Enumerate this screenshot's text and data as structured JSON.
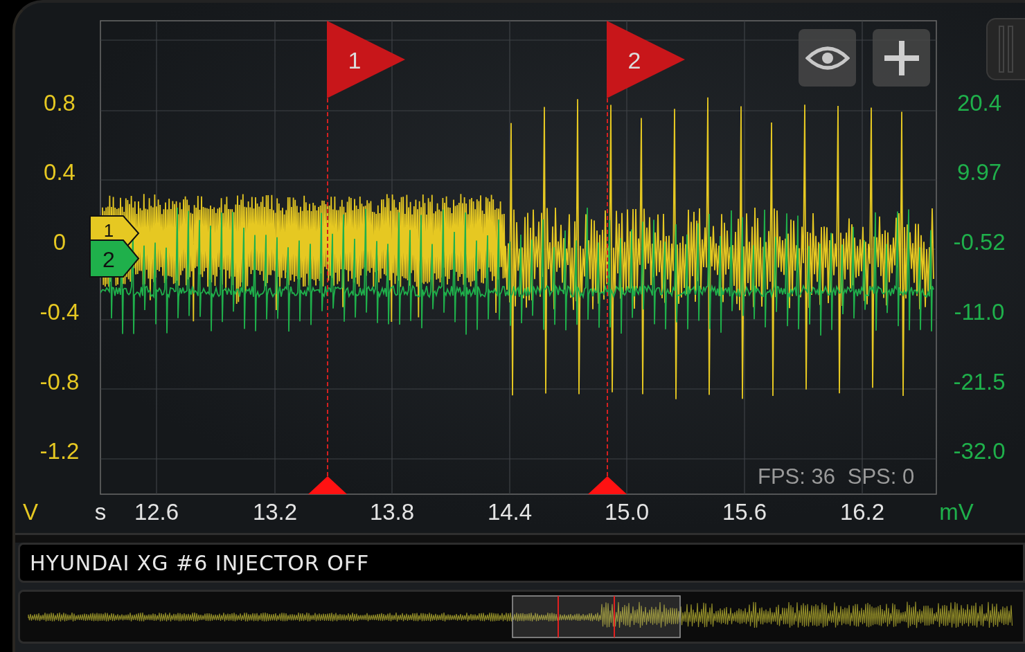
{
  "scope": {
    "left_axis": {
      "unit": "V",
      "ticks": [
        "0.8",
        "0.4",
        "0",
        "-0.4",
        "-0.8",
        "-1.2"
      ]
    },
    "right_axis": {
      "unit": "mV",
      "ticks": [
        "20.4",
        "9.97",
        "-0.52",
        "-11.0",
        "-21.5",
        "-32.0"
      ]
    },
    "time_axis": {
      "unit": "s",
      "ticks": [
        "12.6",
        "13.2",
        "13.8",
        "14.4",
        "15.0",
        "15.6",
        "16.2"
      ]
    },
    "cursors": [
      {
        "label": "1"
      },
      {
        "label": "2"
      }
    ],
    "channels": [
      {
        "label": "1",
        "color": "#e6c822"
      },
      {
        "label": "2",
        "color": "#1fb04b"
      }
    ],
    "stats": [
      "FPS: 36",
      "SPS: 0"
    ]
  },
  "title": "HYUNDAI XG #6 INJECTOR OFF"
}
